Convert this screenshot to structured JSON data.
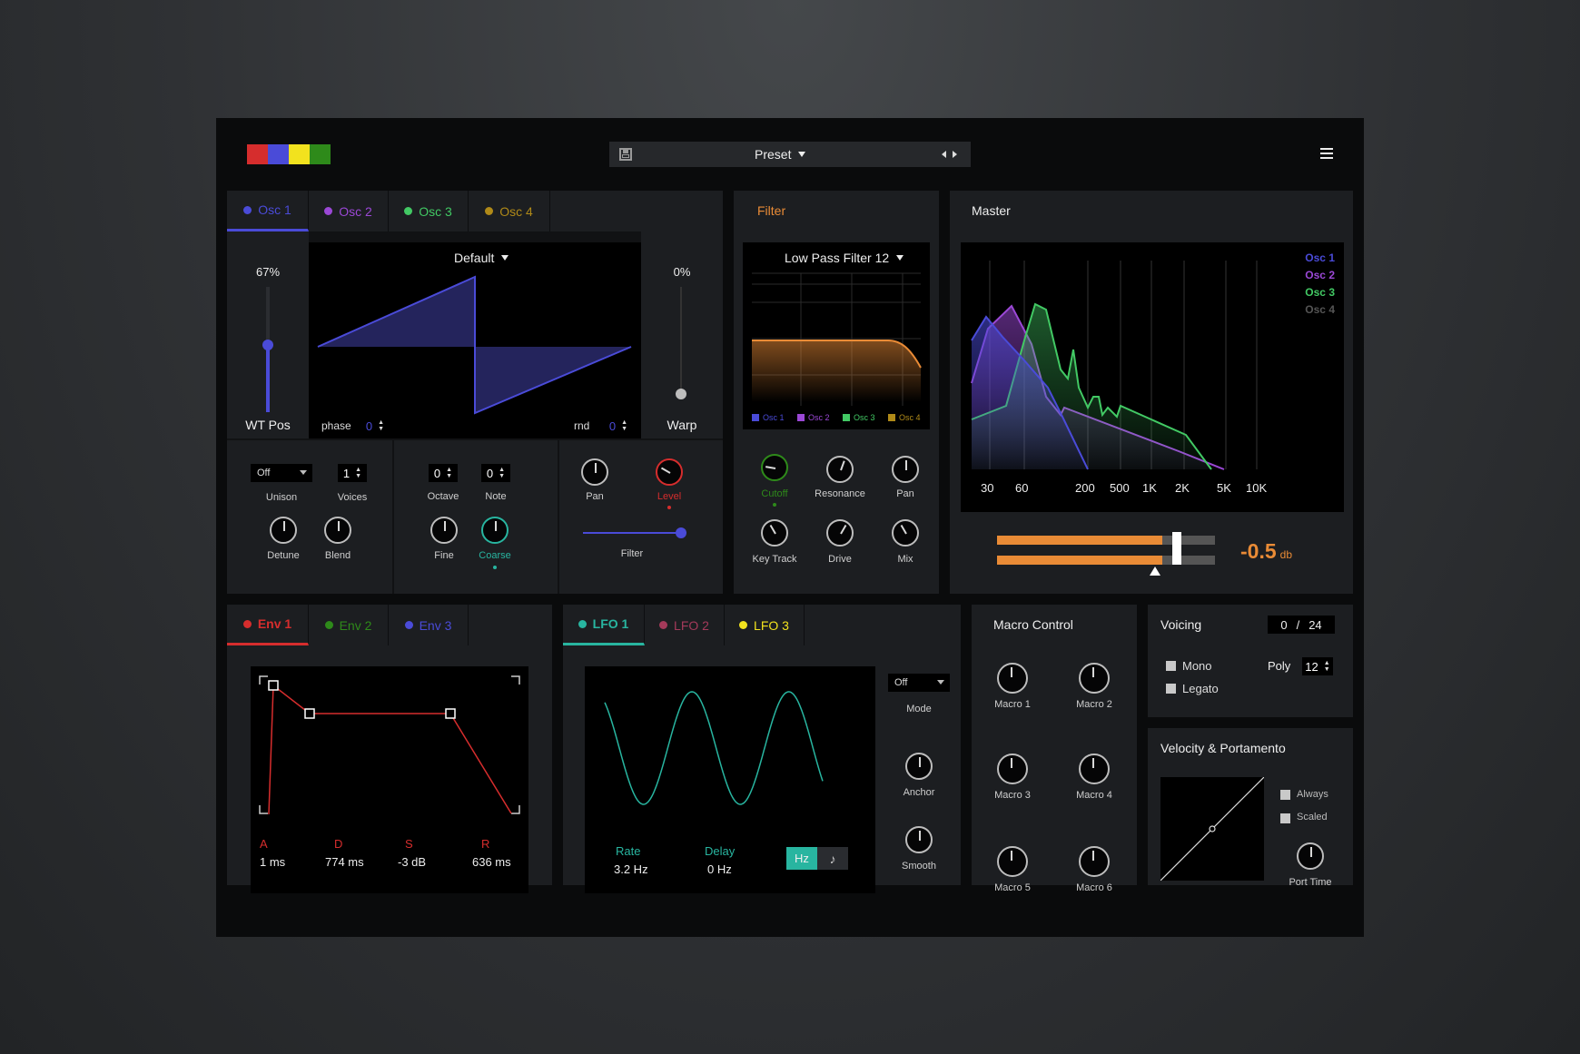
{
  "colors": {
    "red": "#d62d2d",
    "blue": "#4a4bd8",
    "purple": "#9b48d6",
    "green": "#42c964",
    "olive": "#b08a18",
    "orange": "#e98b36",
    "teal": "#28b5a0",
    "yellow": "#f2e21e",
    "darkgreen": "#2e8a1a"
  },
  "header": {
    "preset_label": "Preset",
    "save_icon": "save-icon",
    "menu_icon": "menu-icon"
  },
  "osc": {
    "tabs": [
      "Osc 1",
      "Osc 2",
      "Osc 3",
      "Osc 4"
    ],
    "wt_pos_value": "67%",
    "wt_pos_label": "WT Pos",
    "wt_pos_level": 0.67,
    "warp_value": "0%",
    "warp_label": "Warp",
    "warp_level": 0.0,
    "waveform_preset": "Default",
    "phase_label": "phase",
    "phase_value": "0",
    "rnd_label": "rnd",
    "rnd_value": "0",
    "unison_value": "Off",
    "unison_label": "Unison",
    "voices_value": "1",
    "voices_label": "Voices",
    "detune_label": "Detune",
    "blend_label": "Blend",
    "octave_value": "0",
    "octave_label": "Octave",
    "note_value": "0",
    "note_label": "Note",
    "fine_label": "Fine",
    "coarse_label": "Coarse",
    "pan_label": "Pan",
    "level_label": "Level",
    "filter_label": "Filter",
    "filter_level": 0.95
  },
  "filter": {
    "title": "Filter",
    "type": "Low Pass Filter 12",
    "legend": [
      "Osc 1",
      "Osc 2",
      "Osc 3",
      "Osc 4"
    ],
    "knobs": [
      "Cutoff",
      "Resonance",
      "Pan",
      "Key Track",
      "Drive",
      "Mix"
    ]
  },
  "master": {
    "title": "Master",
    "legend": [
      "Osc 1",
      "Osc 2",
      "Osc 3",
      "Osc 4"
    ],
    "freq_labels": [
      "30",
      "60",
      "200",
      "500",
      "1K",
      "2K",
      "5K",
      "10K"
    ],
    "gain_value": "-0.5",
    "gain_unit": "db",
    "meter_level": 0.76
  },
  "env": {
    "tabs": [
      "Env 1",
      "Env 2",
      "Env 3"
    ],
    "params": [
      {
        "letter": "A",
        "value": "1 ms"
      },
      {
        "letter": "D",
        "value": "774 ms"
      },
      {
        "letter": "S",
        "value": "-3 dB"
      },
      {
        "letter": "R",
        "value": "636 ms"
      }
    ]
  },
  "lfo": {
    "tabs": [
      "LFO 1",
      "LFO 2",
      "LFO 3"
    ],
    "rate_label": "Rate",
    "rate_value": "3.2 Hz",
    "delay_label": "Delay",
    "delay_value": "0 Hz",
    "hz_label": "Hz",
    "note_icon": "music-note-icon",
    "mode_value": "Off",
    "mode_label": "Mode",
    "anchor_label": "Anchor",
    "smooth_label": "Smooth"
  },
  "macro": {
    "title": "Macro Control",
    "items": [
      "Macro 1",
      "Macro 2",
      "Macro 3",
      "Macro 4",
      "Macro 5",
      "Macro 6"
    ]
  },
  "voicing": {
    "title": "Voicing",
    "count_current": "0",
    "count_sep": "/",
    "count_total": "24",
    "mono": "Mono",
    "legato": "Legato",
    "poly": "Poly",
    "poly_value": "12"
  },
  "velocity": {
    "title": "Velocity & Portamento",
    "always": "Always",
    "scaled": "Scaled",
    "port_time": "Port Time"
  }
}
